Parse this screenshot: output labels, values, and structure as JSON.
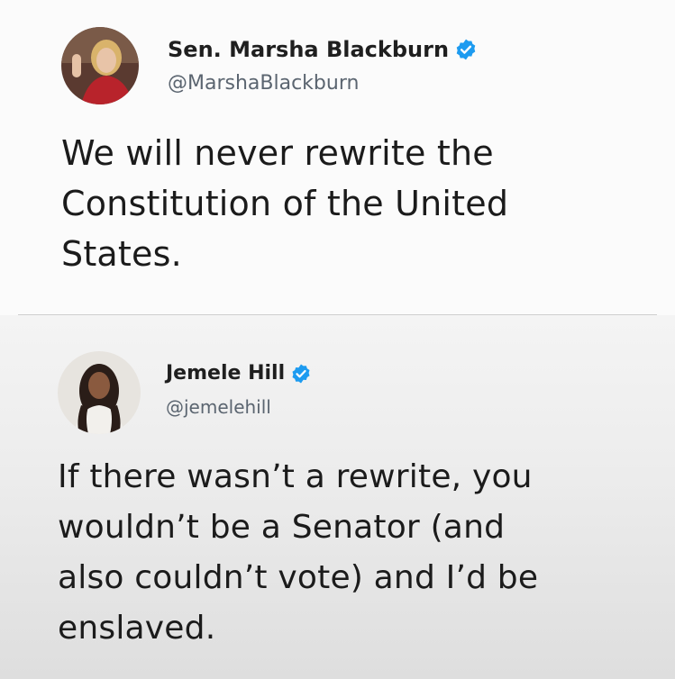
{
  "tweets": [
    {
      "author_name": "Sen. Marsha Blackburn",
      "handle": "@MarshaBlackburn",
      "verified": true,
      "avatar_icon": "avatar-photo-woman-blonde",
      "text_lines": [
        "We will never rewrite the",
        "Constitution of the United",
        "States."
      ]
    },
    {
      "author_name": "Jemele Hill",
      "handle": "@jemelehill",
      "verified": true,
      "avatar_icon": "avatar-photo-woman-dark-hair",
      "text_lines": [
        "If there wasn’t a rewrite, you",
        "wouldn’t be a Senator (and",
        "also couldn’t vote) and I’d be",
        "enslaved."
      ]
    }
  ],
  "colors": {
    "verified_badge": "#1d9bf0",
    "handle": "#5b6570",
    "text": "#1b1b1b"
  }
}
